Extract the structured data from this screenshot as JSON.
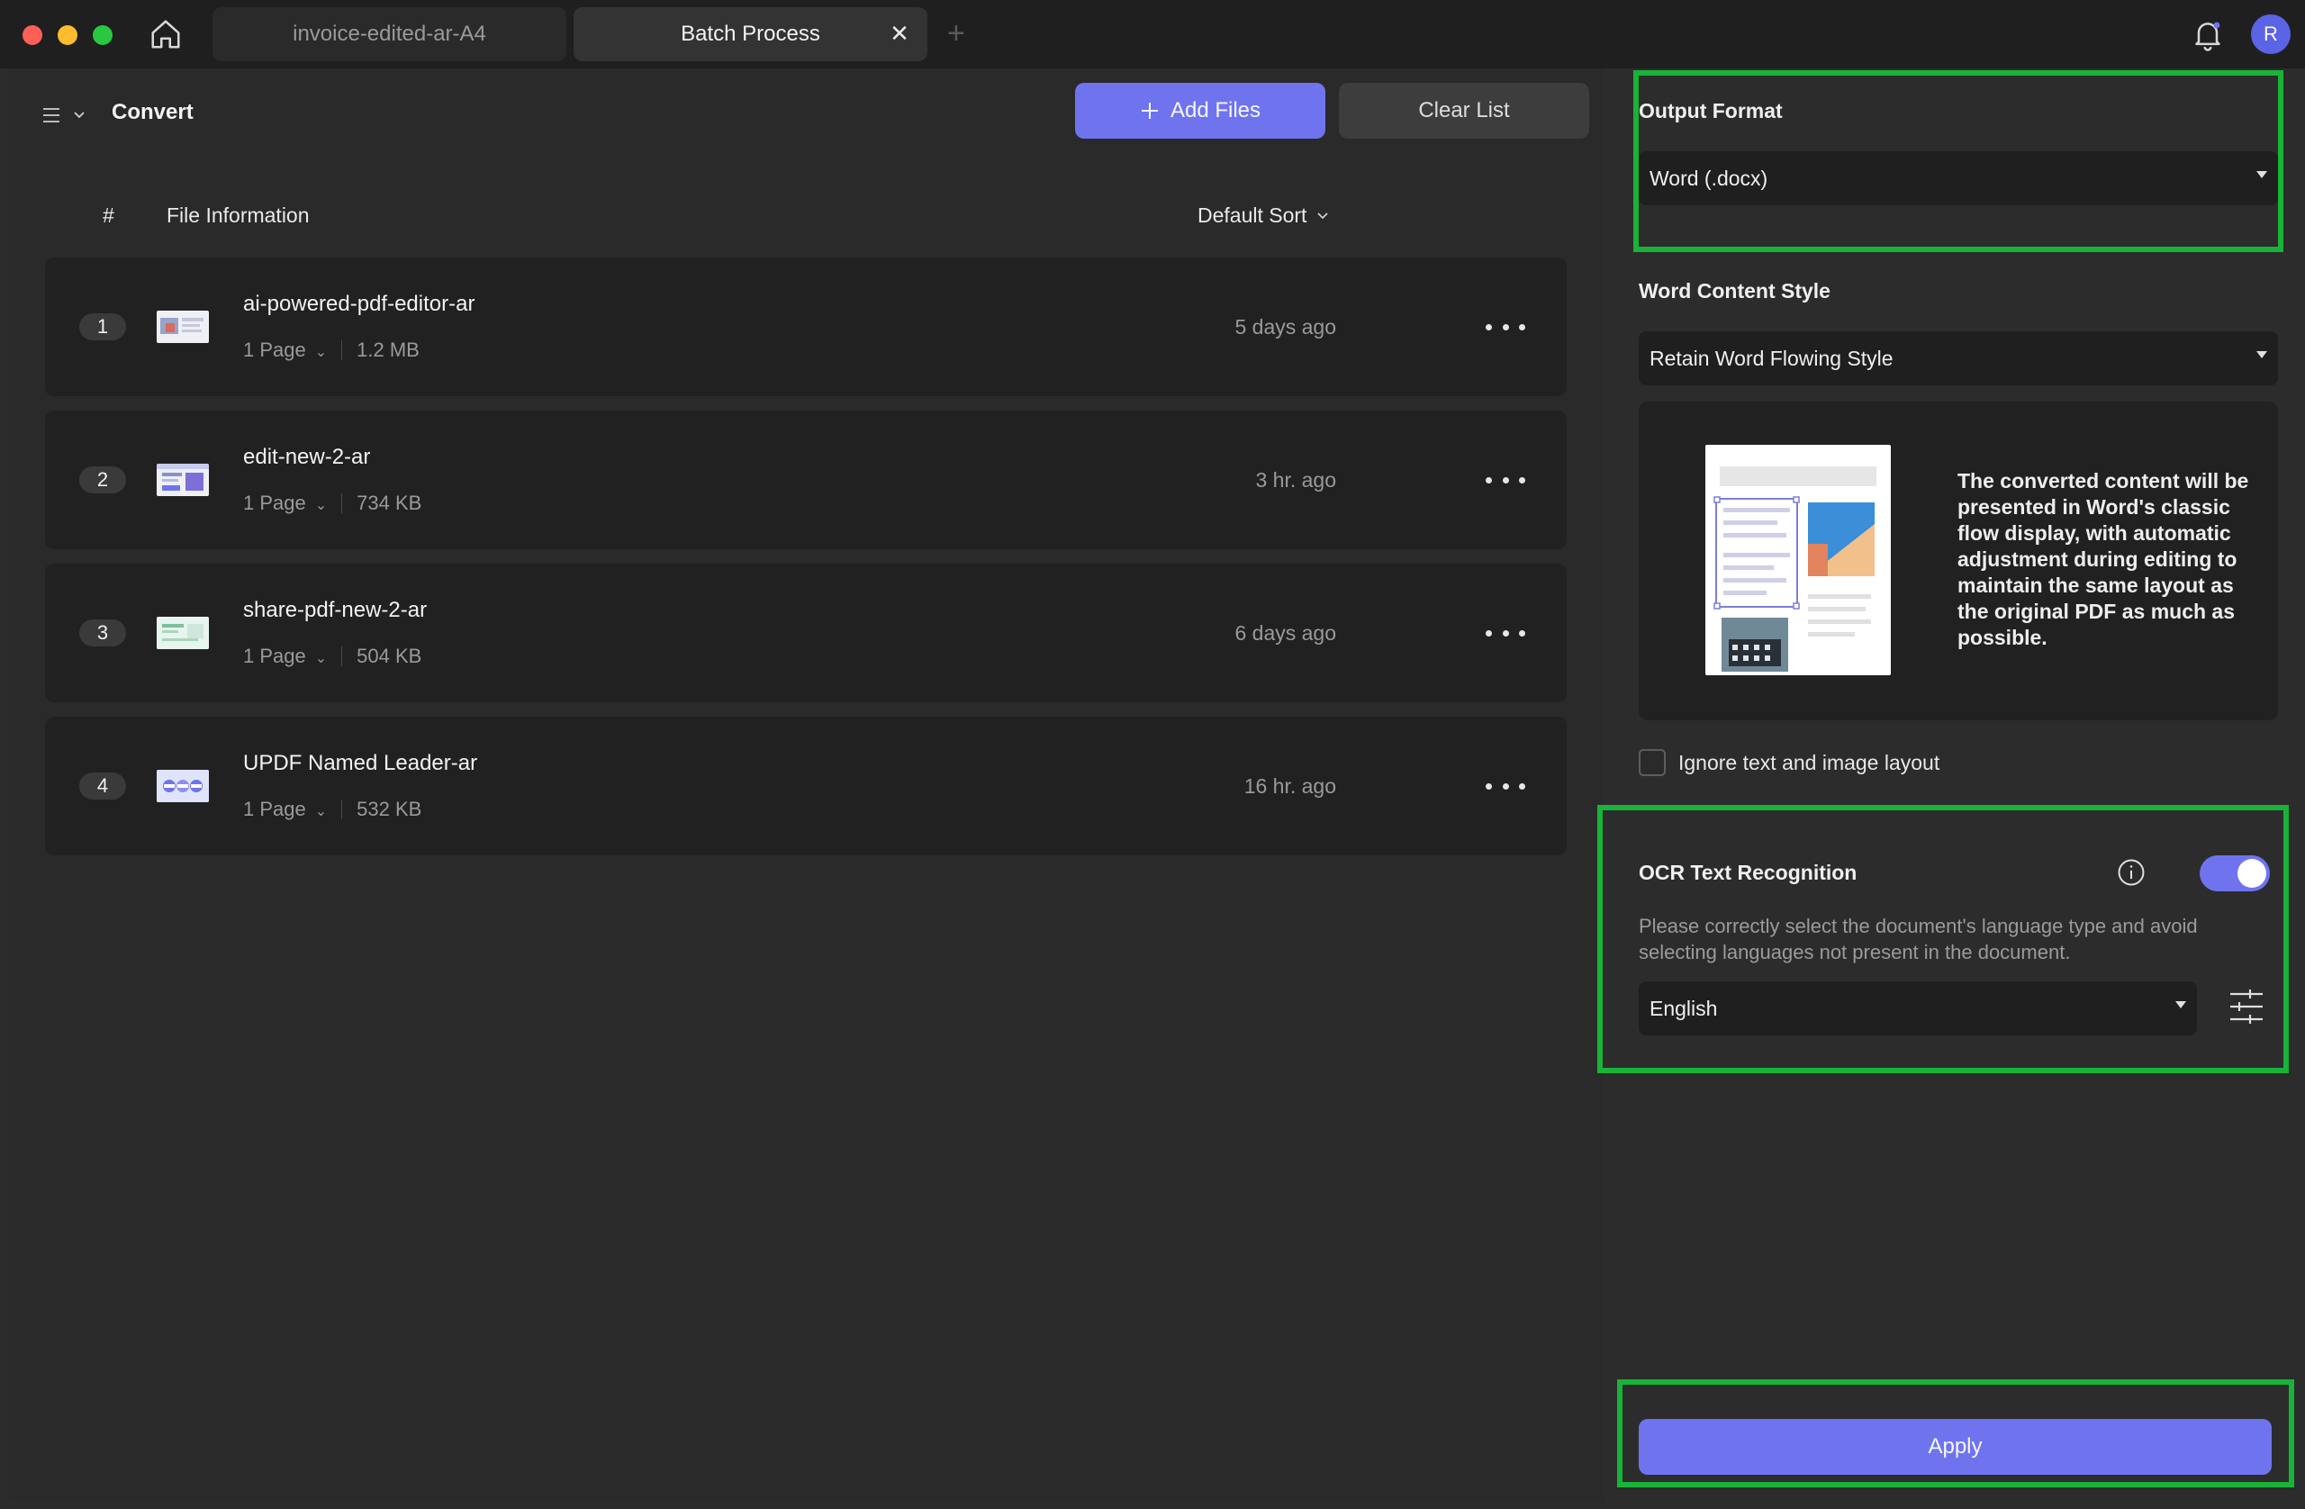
{
  "colors": {
    "accent": "#6f74ee",
    "highlight": "#18b338",
    "traffic_red": "#fe5f57",
    "traffic_yellow": "#febc2e",
    "traffic_green": "#28c840"
  },
  "titlebar": {
    "tabs": [
      {
        "label": "invoice-edited-ar-A4",
        "active": false
      },
      {
        "label": "Batch Process",
        "active": true
      }
    ],
    "close_glyph": "✕",
    "add_glyph": "+",
    "avatar_initial": "R",
    "icons": [
      "home-icon",
      "bell-icon"
    ]
  },
  "toolbar": {
    "title": "Convert",
    "add_files_label": "Add Files",
    "clear_list_label": "Clear List"
  },
  "table": {
    "col_hash": "#",
    "col_info": "File Information",
    "sort_label": "Default Sort"
  },
  "files": [
    {
      "index": "1",
      "name": "ai-powered-pdf-editor-ar",
      "pages": "1 Page",
      "size": "1.2 MB",
      "time": "5 days ago"
    },
    {
      "index": "2",
      "name": "edit-new-2-ar",
      "pages": "1 Page",
      "size": "734 KB",
      "time": "3 hr. ago"
    },
    {
      "index": "3",
      "name": "share-pdf-new-2-ar",
      "pages": "1 Page",
      "size": "504 KB",
      "time": "6 days ago"
    },
    {
      "index": "4",
      "name": "UPDF Named Leader-ar",
      "pages": "1 Page",
      "size": "532 KB",
      "time": "16 hr. ago"
    }
  ],
  "settings": {
    "output_format_label": "Output Format",
    "output_format_value": "Word (.docx)",
    "content_style_label": "Word Content Style",
    "content_style_value": "Retain Word Flowing Style",
    "content_style_desc": "The converted content will be presented in Word's classic flow display, with automatic adjustment during editing to maintain the same layout as the original PDF as much as possible.",
    "ignore_layout_label": "Ignore text and image layout",
    "ignore_layout_checked": false,
    "ocr_label": "OCR Text Recognition",
    "ocr_enabled": true,
    "ocr_desc": "Please correctly select the document's language type and avoid selecting languages not present in the document.",
    "ocr_language": "English",
    "apply_label": "Apply"
  }
}
